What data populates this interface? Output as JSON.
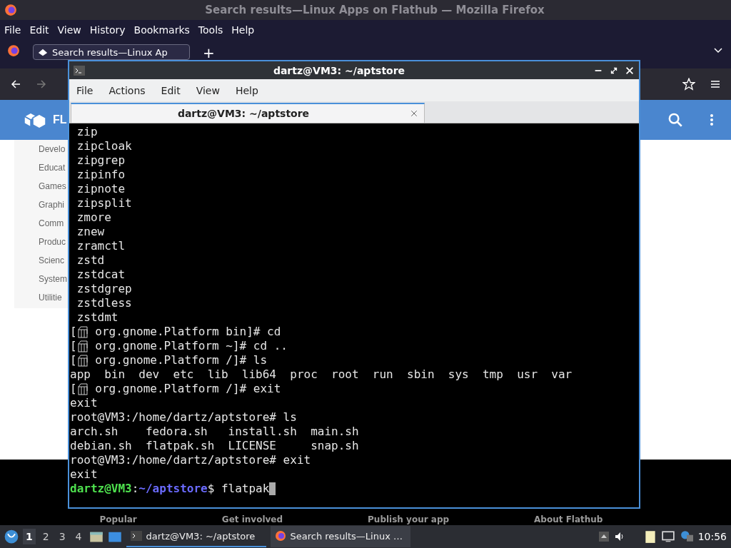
{
  "browser": {
    "title": "Search results—Linux Apps on Flathub — Mozilla Firefox",
    "menu": [
      "File",
      "Edit",
      "View",
      "History",
      "Bookmarks",
      "Tools",
      "Help"
    ],
    "tabs": [
      {
        "label": "Search results—Linux Ap",
        "selected": true
      }
    ],
    "new_tab": "+",
    "site": {
      "brand": "FL",
      "categories": [
        "Develo",
        "Educat",
        "Games",
        "Graphi",
        "Comm",
        "Produc",
        "Scienc",
        "System",
        "Utilitie"
      ],
      "footer_links": [
        "Popular",
        "Get involved",
        "Publish your app",
        "About Flathub"
      ]
    }
  },
  "terminal": {
    "title": "dartz@VM3: ~/aptstore",
    "menu": [
      "File",
      "Actions",
      "Edit",
      "View",
      "Help"
    ],
    "tabs": [
      {
        "label": "dartz@VM3: ~/aptstore",
        "selected": true
      }
    ],
    "lines": [
      {
        "kind": "text",
        "text": " zip"
      },
      {
        "kind": "text",
        "text": " zipcloak"
      },
      {
        "kind": "text",
        "text": " zipgrep"
      },
      {
        "kind": "text",
        "text": " zipinfo"
      },
      {
        "kind": "text",
        "text": " zipnote"
      },
      {
        "kind": "text",
        "text": " zipsplit"
      },
      {
        "kind": "text",
        "text": " zmore"
      },
      {
        "kind": "text",
        "text": " znew"
      },
      {
        "kind": "text",
        "text": " zramctl"
      },
      {
        "kind": "text",
        "text": " zstd"
      },
      {
        "kind": "text",
        "text": " zstdcat"
      },
      {
        "kind": "text",
        "text": " zstdgrep"
      },
      {
        "kind": "text",
        "text": " zstdless"
      },
      {
        "kind": "text",
        "text": " zstdmt"
      },
      {
        "kind": "container",
        "before": "[",
        "text": " org.gnome.Platform bin]# cd"
      },
      {
        "kind": "container",
        "before": "[",
        "text": " org.gnome.Platform ~]# cd .."
      },
      {
        "kind": "container",
        "before": "[",
        "text": " org.gnome.Platform /]# ls"
      },
      {
        "kind": "text",
        "text": "app  bin  dev  etc  lib  lib64  proc  root  run  sbin  sys  tmp  usr  var"
      },
      {
        "kind": "container",
        "before": "[",
        "text": " org.gnome.Platform /]# exit"
      },
      {
        "kind": "text",
        "text": "exit"
      },
      {
        "kind": "text",
        "text": "root@VM3:/home/dartz/aptstore# ls"
      },
      {
        "kind": "text",
        "text": "arch.sh    fedora.sh   install.sh  main.sh"
      },
      {
        "kind": "text",
        "text": "debian.sh  flatpak.sh  LICENSE     snap.sh"
      },
      {
        "kind": "text",
        "text": "root@VM3:/home/dartz/aptstore# exit"
      },
      {
        "kind": "text",
        "text": "exit"
      },
      {
        "kind": "prompt",
        "user": "dartz@VM3",
        "sep": ":",
        "path": "~/aptstore",
        "command": "$ flatpak"
      }
    ]
  },
  "taskbar": {
    "workspaces": [
      {
        "label": "1",
        "selected": true
      },
      {
        "label": "2",
        "selected": false
      },
      {
        "label": "3",
        "selected": false
      },
      {
        "label": "4",
        "selected": false
      }
    ],
    "tasks": [
      {
        "kind": "terminal",
        "label": "dartz@VM3: ~/aptstore",
        "selected": true
      },
      {
        "kind": "browser",
        "label": "Search results—Linux …",
        "selected": false
      }
    ],
    "clock": "10:56"
  }
}
